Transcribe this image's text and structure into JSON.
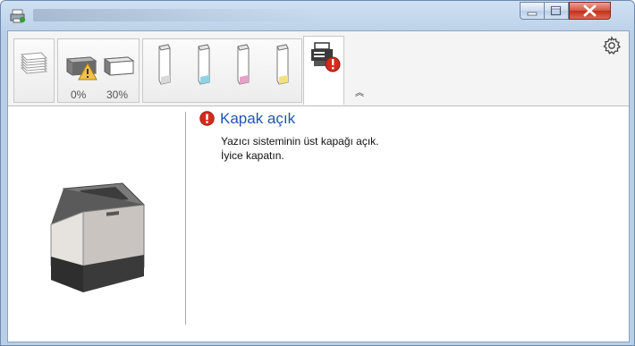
{
  "window": {
    "title": "",
    "caption_buttons": {
      "minimize": "minimize-icon",
      "maximize": "maximize-icon",
      "close": "close-icon"
    }
  },
  "toolbar": {
    "tabs": [
      {
        "name": "jobs",
        "icon": "paper-stack-icon"
      },
      {
        "name": "paper-trays",
        "icon": "paper-tray-icon"
      },
      {
        "name": "toner",
        "icon": "toner-cartridge-icon"
      },
      {
        "name": "device",
        "icon": "printer-warning-icon"
      }
    ],
    "trays": [
      {
        "level_label": "0%",
        "warning": true
      },
      {
        "level_label": "30%",
        "warning": false
      }
    ],
    "toner_colors": [
      "#d9d9d9",
      "#8fd3e8",
      "#e8a0c8",
      "#f2e27a"
    ],
    "collapse_glyph": "︽",
    "settings_icon": "gear-icon"
  },
  "status": {
    "title": "Kapak açık",
    "line1": "Yazıcı sisteminin üst kapağı açık.",
    "line2": "İyice kapatın.",
    "icon": "error-icon",
    "accent": "#2255b0",
    "error_color": "#d42a1e"
  }
}
